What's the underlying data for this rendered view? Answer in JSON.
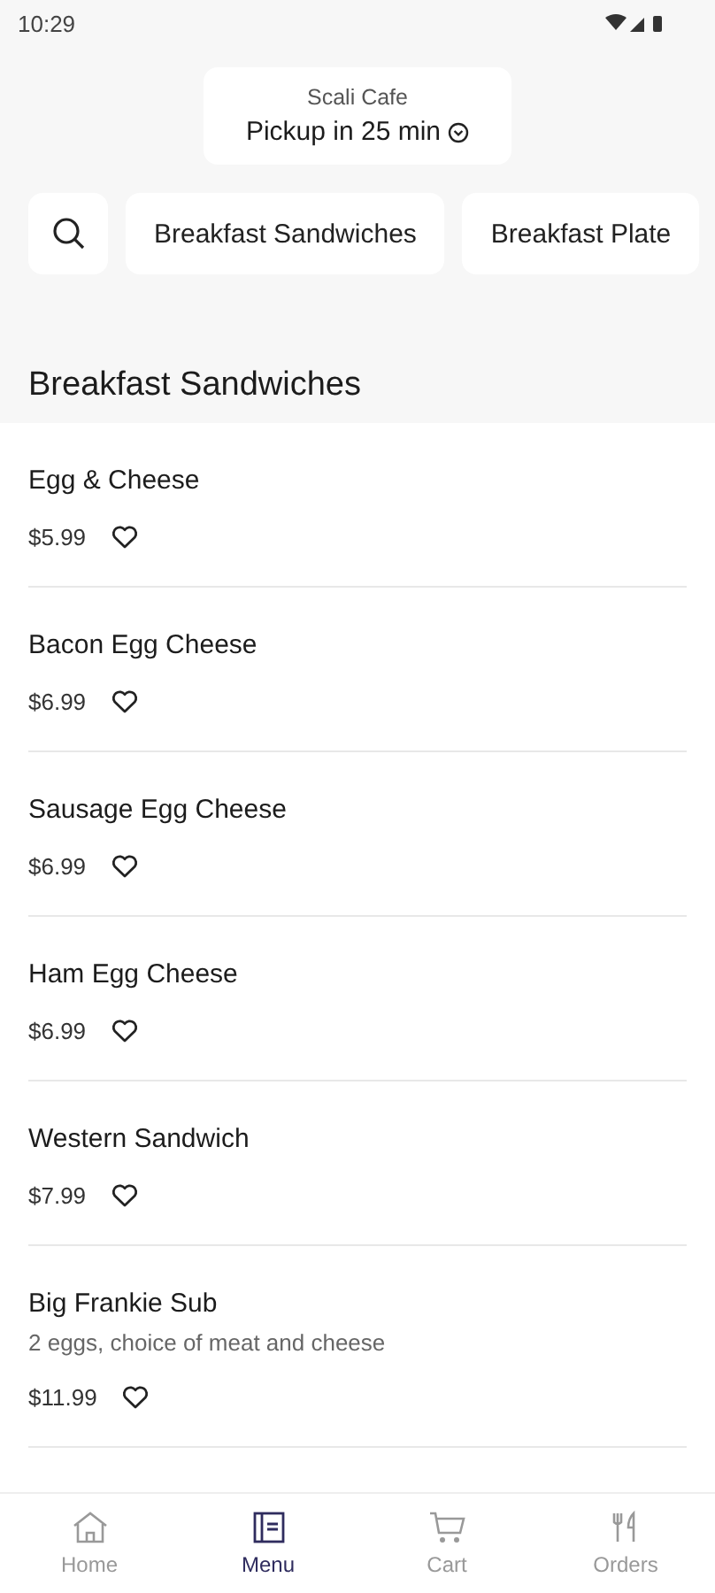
{
  "status_bar": {
    "time": "10:29"
  },
  "header": {
    "store": "Scali Cafe",
    "pickup": "Pickup in 25 min"
  },
  "categories": [
    "Breakfast Sandwiches",
    "Breakfast Plate"
  ],
  "section": {
    "title": "Breakfast Sandwiches"
  },
  "items": [
    {
      "name": "Egg & Cheese",
      "price": "$5.99"
    },
    {
      "name": "Bacon Egg Cheese",
      "price": "$6.99"
    },
    {
      "name": "Sausage Egg Cheese",
      "price": "$6.99"
    },
    {
      "name": "Ham Egg Cheese",
      "price": "$6.99"
    },
    {
      "name": "Western Sandwich",
      "price": "$7.99"
    },
    {
      "name": "Big Frankie Sub",
      "description": "2 eggs, choice of meat and cheese",
      "price": "$11.99"
    }
  ],
  "nav": [
    {
      "label": "Home",
      "kind": "home",
      "selected": false
    },
    {
      "label": "Menu",
      "kind": "menu",
      "selected": true
    },
    {
      "label": "Cart",
      "kind": "cart",
      "selected": false
    },
    {
      "label": "Orders",
      "kind": "orders",
      "selected": false
    }
  ]
}
